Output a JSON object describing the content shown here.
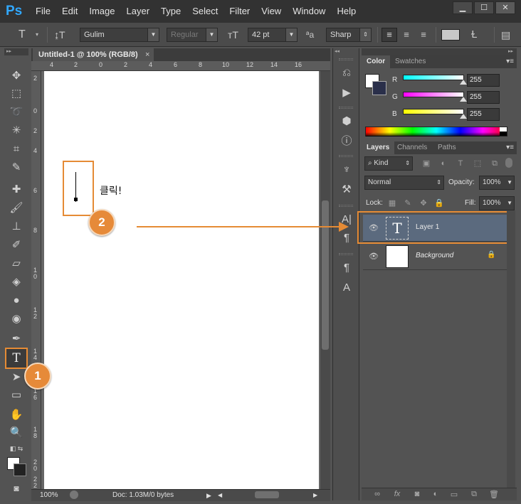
{
  "app": {
    "logo": "Ps"
  },
  "menu": [
    "File",
    "Edit",
    "Image",
    "Layer",
    "Type",
    "Select",
    "Filter",
    "View",
    "Window",
    "Help"
  ],
  "window_controls": {
    "minimize": "▁",
    "maximize": "☐",
    "close": "✕"
  },
  "options_bar": {
    "font_family": "Gulim",
    "font_style": "Regular",
    "font_size": "42 pt",
    "antialias_glyph": "ªa",
    "antialias": "Sharp"
  },
  "document": {
    "tab_title": "Untitled-1 @ 100% (RGB/8)",
    "tab_close": "×",
    "ruler_top": [
      "4",
      "2",
      "0",
      "2",
      "4",
      "6",
      "8",
      "10",
      "12",
      "14",
      "16"
    ],
    "ruler_left": [
      "2",
      "0",
      "2",
      "4",
      "6",
      "8",
      "1\n0",
      "1\n2",
      "1\n4",
      "1\n6",
      "1\n8",
      "2\n0",
      "2\n2"
    ],
    "canvas_text": "클릭!",
    "zoom": "100%",
    "doc_info": "Doc: 1.03M/0 bytes"
  },
  "color_panel": {
    "tabs": [
      "Color",
      "Swatches"
    ],
    "channels": [
      {
        "label": "R",
        "value": "255",
        "gradient": "linear-gradient(to right, #00ffff, #ffffff)"
      },
      {
        "label": "G",
        "value": "255",
        "gradient": "linear-gradient(to right, #ff00ff, #ffffff)"
      },
      {
        "label": "B",
        "value": "255",
        "gradient": "linear-gradient(to right, #ffff00, #ffffff)"
      }
    ]
  },
  "layers_panel": {
    "tabs": [
      "Layers",
      "Channels",
      "Paths"
    ],
    "kind_filter": "Kind",
    "blend_mode": "Normal",
    "opacity_label": "Opacity:",
    "opacity": "100%",
    "lock_label": "Lock:",
    "fill_label": "Fill:",
    "fill": "100%",
    "layers": [
      {
        "name": "Layer 1",
        "type": "text",
        "selected": true
      },
      {
        "name": "Background",
        "type": "background",
        "locked": true
      }
    ]
  },
  "annotations": {
    "badge1": "1",
    "badge2": "2"
  },
  "colors": {
    "accent_orange": "#e58b35",
    "selected_layer": "#5b6a7e"
  }
}
